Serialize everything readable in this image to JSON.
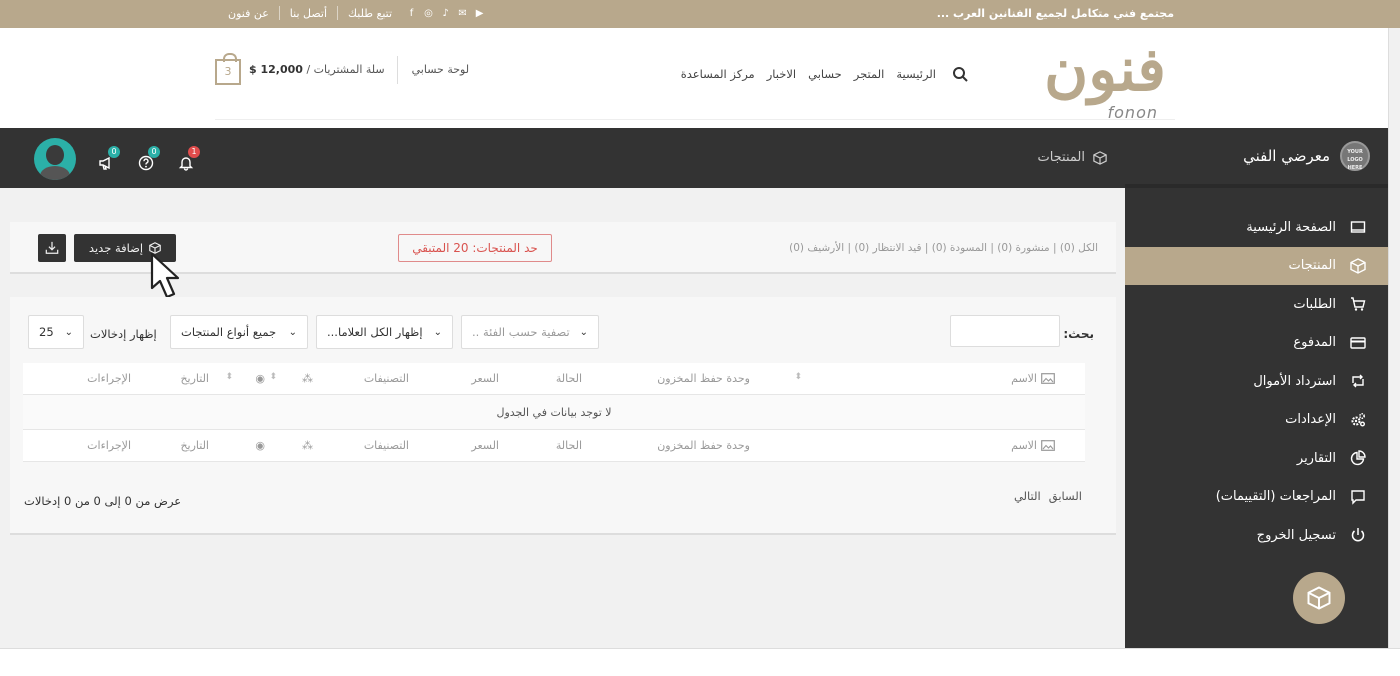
{
  "topbar": {
    "tagline": "مجتمع فني متكامل لجميع الفنانين العرب ...",
    "links": [
      "عن فنون",
      "أتصل بنا",
      "تتبع طلبك"
    ]
  },
  "logo": {
    "arabic": "فنون",
    "latin": "fonon"
  },
  "mainnav": {
    "items": [
      "الرئيسية",
      "المتجر",
      "حسابي",
      "الاخبار",
      "مركز المساعدة"
    ]
  },
  "account": {
    "dashboard_link": "لوحة حسابي",
    "cart_label": "سلة المشتريات /",
    "cart_total": "12,000 $",
    "cart_count": "3"
  },
  "dashbar": {
    "breadcrumb": "المنتجات",
    "notifications_count": "1",
    "help_count": "0",
    "announcements_count": "0"
  },
  "sidebar": {
    "brand_name": "معرضي الفني",
    "brand_logo_text": "YOUR LOGO HERE",
    "items": [
      {
        "label": "الصفحة الرئيسية",
        "icon": "dashboard-icon"
      },
      {
        "label": "المنتجات",
        "icon": "box-icon",
        "active": true
      },
      {
        "label": "الطلبات",
        "icon": "cart-icon"
      },
      {
        "label": "المدفوع",
        "icon": "credit-card-icon"
      },
      {
        "label": "استرداد الأموال",
        "icon": "refund-icon"
      },
      {
        "label": "الإعدادات",
        "icon": "gears-icon"
      },
      {
        "label": "التقارير",
        "icon": "pie-chart-icon"
      },
      {
        "label": "المراجعات (التقييمات)",
        "icon": "comment-icon"
      },
      {
        "label": "تسجيل الخروج",
        "icon": "power-icon"
      }
    ]
  },
  "products": {
    "status_links": "الكل (0) | منشورة (0) | المسودة (0) | قيد الانتظار (0) | الأرشيف (0)",
    "limit_text": "حد المنتجات: 20 المتبقي",
    "add_new_label": "إضافة جديد"
  },
  "filters": {
    "search_label": "بحث:",
    "search_value": "",
    "category_placeholder": "تصفية حسب الفئة ..",
    "brands_label": "إظهار الكل العلاما...",
    "types_label": "جميع أنواع المنتجات",
    "entries_label": "إظهار إدخالات",
    "entries_value": "25"
  },
  "table": {
    "columns": {
      "name": "الاسم",
      "sku": "وحدة حفظ المخزون",
      "status": "الحالة",
      "price": "السعر",
      "categories": "التصنيفات",
      "date": "التاريخ",
      "actions": "الإجراءات"
    },
    "empty_message": "لا توجد بيانات في الجدول"
  },
  "pagination": {
    "prev": "السابق",
    "next": "التالي",
    "info": "عرض من 0 إلى 0 من 0 إدخالات"
  },
  "colors": {
    "accent": "#b8a88c",
    "dark": "#333333",
    "teal": "#2bb0a8",
    "danger": "#d9534f"
  }
}
